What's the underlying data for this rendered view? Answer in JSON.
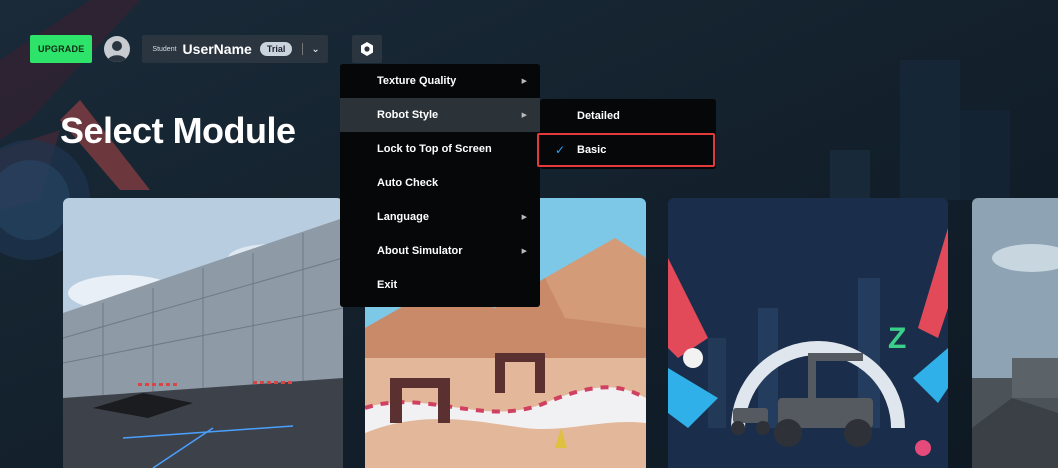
{
  "header": {
    "upgrade_label": "UPGRADE",
    "role": "Student",
    "username": "UserName",
    "badge": "Trial"
  },
  "page_title": "Select Module",
  "settings_menu": {
    "items": [
      {
        "label": "Texture Quality",
        "has_submenu": true
      },
      {
        "label": "Robot Style",
        "has_submenu": true
      },
      {
        "label": "Lock to Top of Screen",
        "has_submenu": false
      },
      {
        "label": "Auto Check",
        "has_submenu": false
      },
      {
        "label": "Language",
        "has_submenu": true
      },
      {
        "label": "About Simulator",
        "has_submenu": true
      },
      {
        "label": "Exit",
        "has_submenu": false
      }
    ],
    "active_index": 1
  },
  "robot_style_submenu": {
    "items": [
      {
        "label": "Detailed",
        "checked": false
      },
      {
        "label": "Basic",
        "checked": true
      }
    ]
  },
  "colors": {
    "accent_green": "#2ee36a",
    "check_blue": "#2aa3ff",
    "highlight_red": "#e23a3a"
  }
}
